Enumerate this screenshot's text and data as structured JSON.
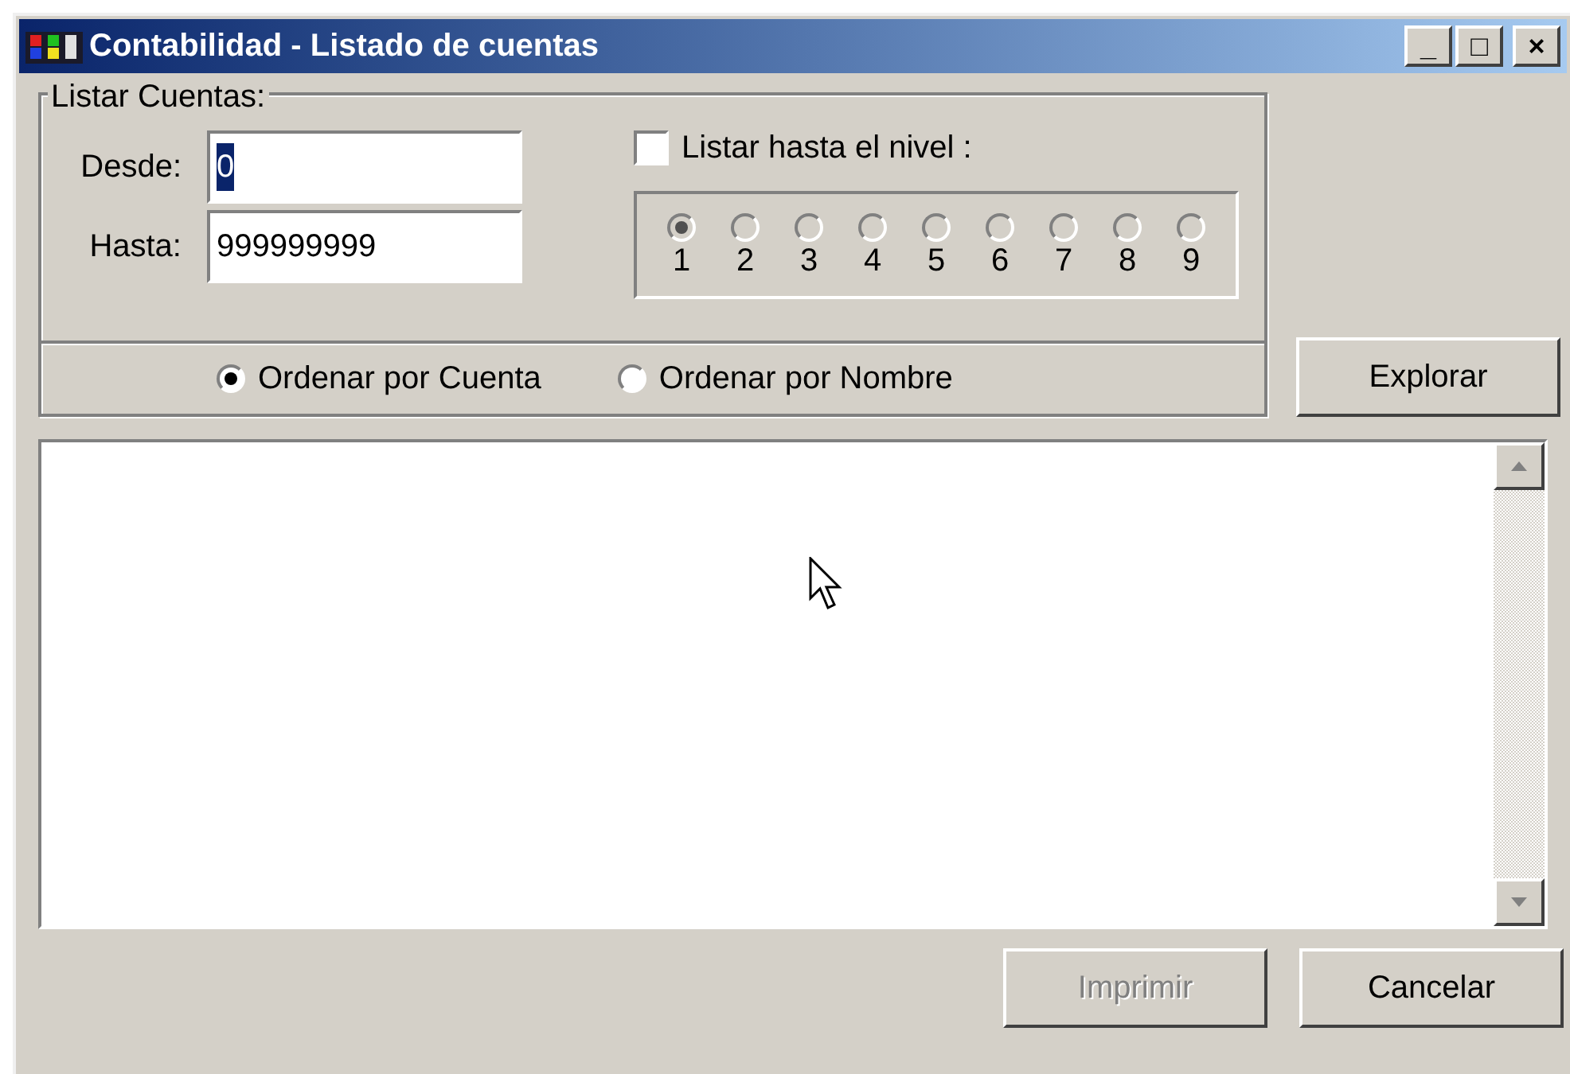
{
  "window": {
    "title": "Contabilidad - Listado de cuentas",
    "controls": [
      "_",
      "□",
      "×"
    ]
  },
  "group": {
    "title": "Listar Cuentas:",
    "from": {
      "label": "Desde:",
      "value": "0",
      "selected": true
    },
    "to": {
      "label": "Hasta:",
      "value": "999999999",
      "selected": false
    },
    "level_check": {
      "label": "Listar hasta el nivel :",
      "checked": false
    },
    "levels": {
      "disabled": true,
      "options": [
        {
          "label": "1",
          "selected": true
        },
        {
          "label": "2",
          "selected": false
        },
        {
          "label": "3",
          "selected": false
        },
        {
          "label": "4",
          "selected": false
        },
        {
          "label": "5",
          "selected": false
        },
        {
          "label": "6",
          "selected": false
        },
        {
          "label": "7",
          "selected": false
        },
        {
          "label": "8",
          "selected": false
        },
        {
          "label": "9",
          "selected": false
        }
      ]
    },
    "order": [
      {
        "label": "Ordenar por Cuenta",
        "selected": true
      },
      {
        "label": "Ordenar por Nombre",
        "selected": false
      }
    ]
  },
  "explore_button": {
    "label": "Explorar",
    "disabled": false
  },
  "buttons": [
    {
      "label": "Imprimir",
      "disabled": true
    },
    {
      "label": "Cancelar",
      "disabled": false
    }
  ]
}
